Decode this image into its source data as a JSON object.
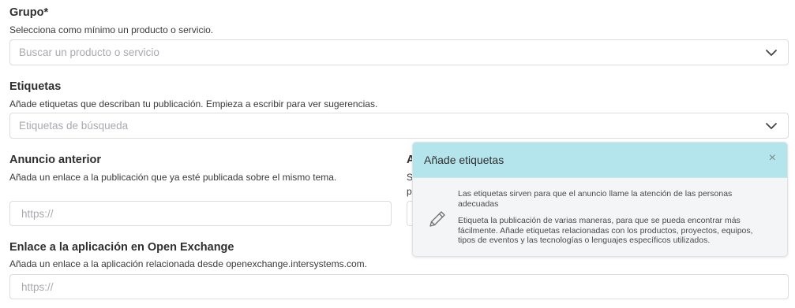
{
  "grupo": {
    "label": "Grupo*",
    "help": "Selecciona como mínimo un producto o servicio.",
    "placeholder": "Buscar un producto o servicio",
    "chevron_icon": "chevron-down-icon"
  },
  "etiquetas": {
    "label": "Etiquetas",
    "help": "Añade etiquetas que describan tu publicación. Empieza a escribir para ver sugerencias.",
    "placeholder": "Etiquetas de búsqueda",
    "chevron_icon": "chevron-down-icon"
  },
  "anuncio_anterior": {
    "label": "Anuncio anterior",
    "help": "Añada un enlace a la publicación que ya esté publicada sobre el mismo tema.",
    "placeholder": "https://"
  },
  "hidden_column": {
    "label_fragment": "A",
    "help_line1_fragment": "S",
    "help_line2_fragment": "p"
  },
  "open_exchange": {
    "label": "Enlace a la aplicación en Open Exchange",
    "help": "Añada un enlace a la aplicación relacionada desde openexchange.intersystems.com.",
    "placeholder": "https://"
  },
  "popover": {
    "title": "Añade etiquetas",
    "close_glyph": "×",
    "icon": "pencil-icon",
    "paragraph1": "Las etiquetas sirven para que el anuncio llame la atención de las personas adecuadas",
    "paragraph2": "Etiqueta la publicación de varias maneras, para que se pueda encontrar más fácilmente. Añade etiquetas relacionadas con los productos, proyectos, equipos, tipos de eventos y las tecnologías o lenguajes específicos utilizados.",
    "header_color": "#b4e4ec",
    "body_color": "#f4f5f6"
  }
}
